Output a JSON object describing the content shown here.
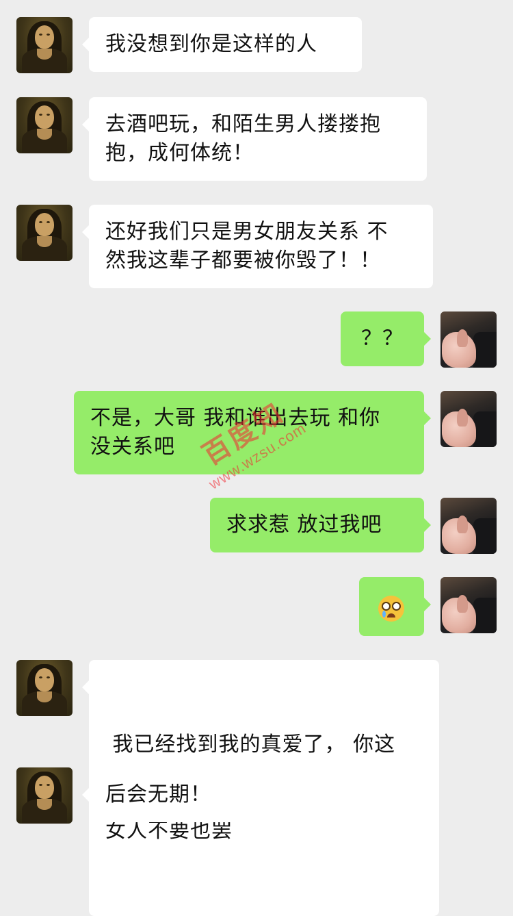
{
  "messages": [
    {
      "side": "left",
      "lines": [
        "我没想到你是这样的人"
      ]
    },
    {
      "side": "left",
      "lines": [
        "去酒吧玩，和陌生男人搂搂抱",
        "抱，成何体统！"
      ]
    },
    {
      "side": "left",
      "lines": [
        "还好我们只是男女朋友关系 不",
        "然我这辈子都要被你毁了！！"
      ]
    },
    {
      "side": "right",
      "lines": [
        "？？"
      ]
    },
    {
      "side": "right",
      "lines": [
        "不是，大哥 我和谁出去玩 和你",
        "没关系吧"
      ]
    },
    {
      "side": "right",
      "lines": [
        "求求惹 放过我吧"
      ]
    },
    {
      "side": "right",
      "emoji": "crying-with-glasses-emoji"
    },
    {
      "side": "left",
      "lines": [
        " 我已经找到我的真爱了， 你这",
        "女人不要也罢"
      ]
    },
    {
      "side": "left",
      "lines": [
        "后会无期！"
      ]
    }
  ],
  "avatars": {
    "left": "mona-lisa-avatar",
    "right": "photo-avatar"
  },
  "colors": {
    "background": "#ededed",
    "left_bubble": "#ffffff",
    "right_bubble": "#95ec69"
  },
  "watermark": {
    "brand": "百度知",
    "url": "www.wzsu.com"
  }
}
